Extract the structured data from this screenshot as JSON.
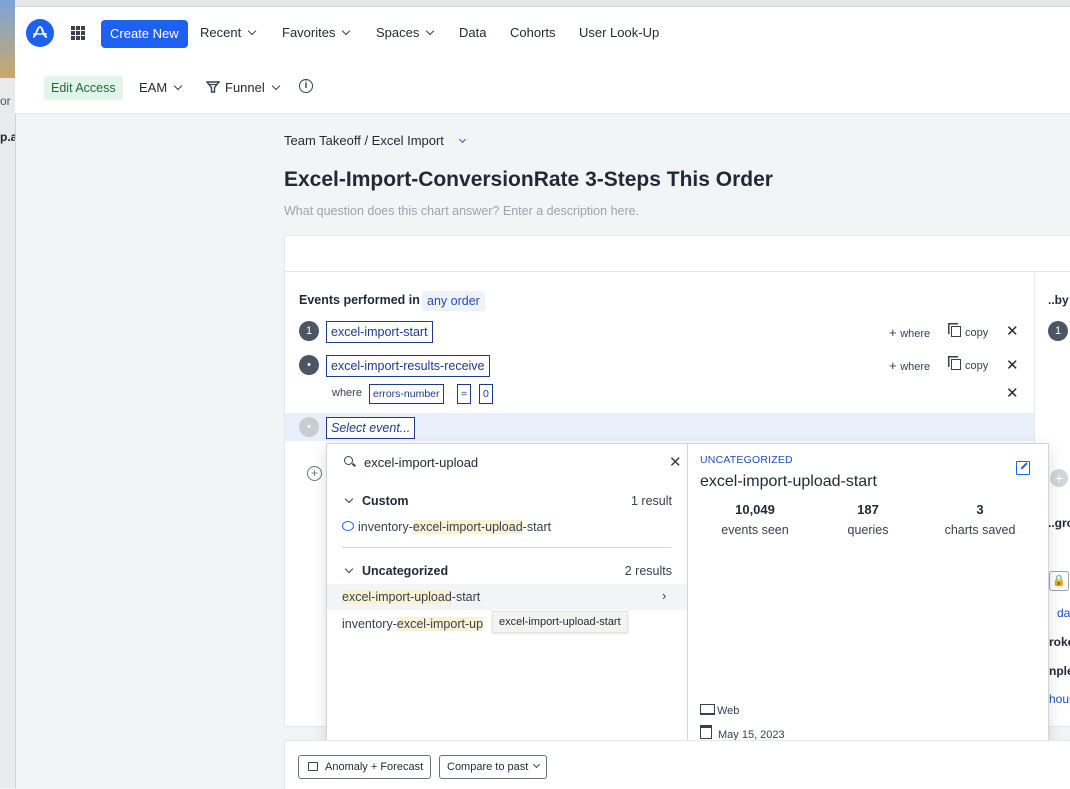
{
  "background_window": {
    "fragments": [
      "or",
      "p.a"
    ]
  },
  "topnav": {
    "create_label": "Create New",
    "items": [
      "Recent",
      "Favorites",
      "Spaces",
      "Data",
      "Cohorts",
      "User Look-Up"
    ]
  },
  "subbar": {
    "edit_access": "Edit Access",
    "eam": "EAM",
    "funnel": "Funnel"
  },
  "breadcrumb": "Team Takeoff / Excel Import",
  "title": "Excel-Import-ConversionRate 3-Steps This Order",
  "description_placeholder": "What question does this chart answer? Enter a description here.",
  "events": {
    "label": "Events performed in",
    "order": "any order",
    "steps": [
      {
        "num": "1",
        "name": "excel-import-start"
      },
      {
        "num": "•",
        "name": "excel-import-results-receive"
      }
    ],
    "where_label": "where",
    "filter": {
      "property": "errors-number",
      "op": "=",
      "value": "0"
    },
    "select_placeholder": "Select event...",
    "row_where": "where",
    "row_copy": "copy"
  },
  "right_panel": {
    "by_label": "..by",
    "num": "1",
    "group_label": "..gro",
    "link": "da",
    "frag1": "roke",
    "frag2": "nple",
    "frag3": "hour"
  },
  "dropdown": {
    "search_value": "excel-import-upload",
    "custom_group": {
      "label": "Custom",
      "count": "1 result",
      "items": [
        {
          "prefix": "inventory-",
          "highlight": "excel-import-upload",
          "suffix": "-start"
        }
      ]
    },
    "uncat_group": {
      "label": "Uncategorized",
      "count": "2 results",
      "items": [
        {
          "prefix": "",
          "highlight": "excel-import-upload",
          "suffix": "-start"
        },
        {
          "prefix": "inventory-",
          "highlight": "excel-import-up",
          "suffix": ""
        }
      ]
    },
    "tooltip": "excel-import-upload-start",
    "detail": {
      "category": "UNCATEGORIZED",
      "name": "excel-import-upload-start",
      "stats": [
        {
          "value": "10,049",
          "label": "events seen"
        },
        {
          "value": "187",
          "label": "queries"
        },
        {
          "value": "3",
          "label": "charts saved"
        }
      ],
      "platform": "Web",
      "date": "May 15, 2023"
    }
  },
  "bottom": {
    "anomaly": "Anomaly + Forecast",
    "compare": "Compare to past"
  }
}
